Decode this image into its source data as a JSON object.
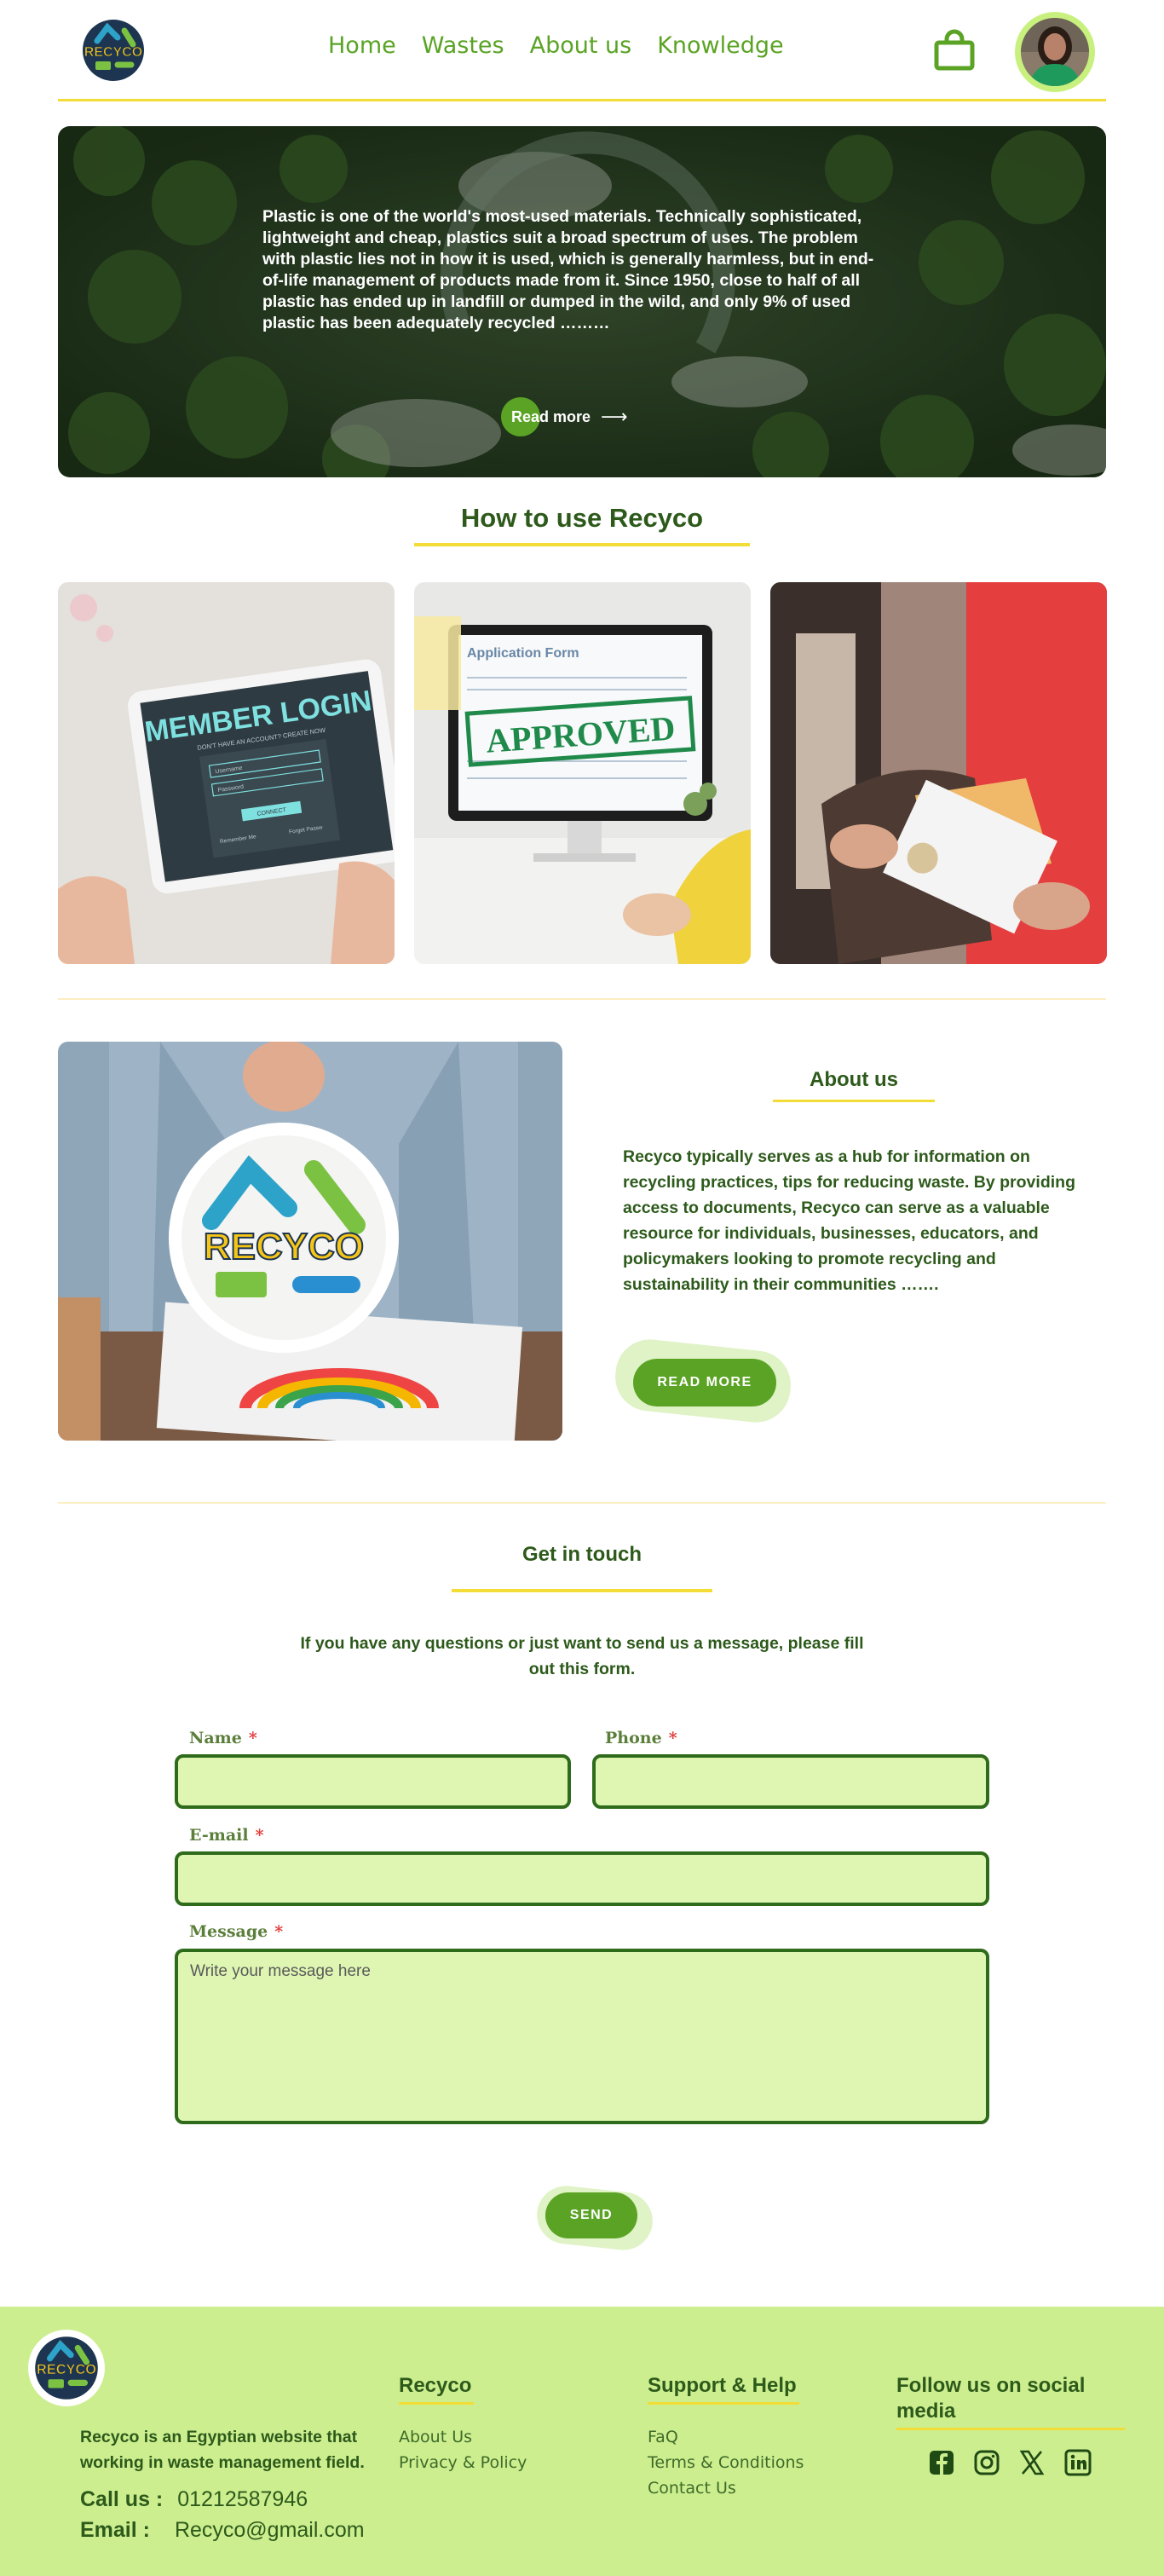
{
  "header": {
    "logo_text": "RECYCO",
    "nav": [
      "Home",
      "Wastes",
      "About us",
      "Knowledge"
    ]
  },
  "hero": {
    "text": "Plastic is one of the world's most-used materials. Technically sophisticated, lightweight and cheap, plastics suit a broad spectrum of uses. The problem with plastic lies not in how it is used, which is generally harmless, but in end-of-life management of products made from it. Since 1950, close to half of all plastic has ended up in landfill or dumped in the wild, and only 9% of used plastic has been adequately recycled ………",
    "button": "Read more"
  },
  "how_to": {
    "title": "How to use Recyco",
    "cards": [
      {
        "heading": "MEMBER LOGIN",
        "subtext": "DON'T HAVE AN ACCOUNT? CREATE NOW",
        "username": "Username",
        "password": "Password",
        "button": "CONNECT",
        "remember": "Remember Me",
        "forgot": "Forget Passw"
      },
      {
        "form_title": "Application Form",
        "stamp": "APPROVED"
      },
      {}
    ]
  },
  "about": {
    "title": "About us",
    "text": "Recyco typically serves as a hub for information on recycling practices, tips for reducing waste. By providing access to documents, Recyco can serve as a valuable resource for individuals, businesses, educators, and policymakers looking to promote recycling and sustainability in their communities …….",
    "button": "READ MORE",
    "image_logo_text": "RECYCO"
  },
  "contact": {
    "title": "Get in touch",
    "intro": "If you have any questions or just want to send us a message, please fill out this form.",
    "name_label": "Name",
    "phone_label": "Phone",
    "email_label": "E-mail",
    "message_label": "Message",
    "message_placeholder": "Write your message here",
    "required_mark": "*",
    "send": "SEND"
  },
  "footer": {
    "logo_text": "RECYCO",
    "description": "Recyco is an Egyptian website that working in waste management field.",
    "call_label": "Call us :",
    "call_value": "01212587946",
    "email_label": "Email :",
    "email_value": "Recyco@gmail.com",
    "col1_title": "Recyco",
    "col1_links": [
      "About Us",
      "Privacy & Policy"
    ],
    "col2_title": "Support & Help",
    "col2_links": [
      "FaQ",
      "Terms & Conditions",
      "Contact Us"
    ],
    "col3_title": "Follow us on social media",
    "social_icons": [
      "facebook-icon",
      "instagram-icon",
      "x-icon",
      "linkedin-icon"
    ]
  },
  "colors": {
    "brand_green": "#5aa324",
    "dark_green": "#2d5a1b",
    "accent_yellow": "#f3dc35",
    "field_bg": "#dff6b3",
    "footer_bg": "#ccee8f"
  }
}
